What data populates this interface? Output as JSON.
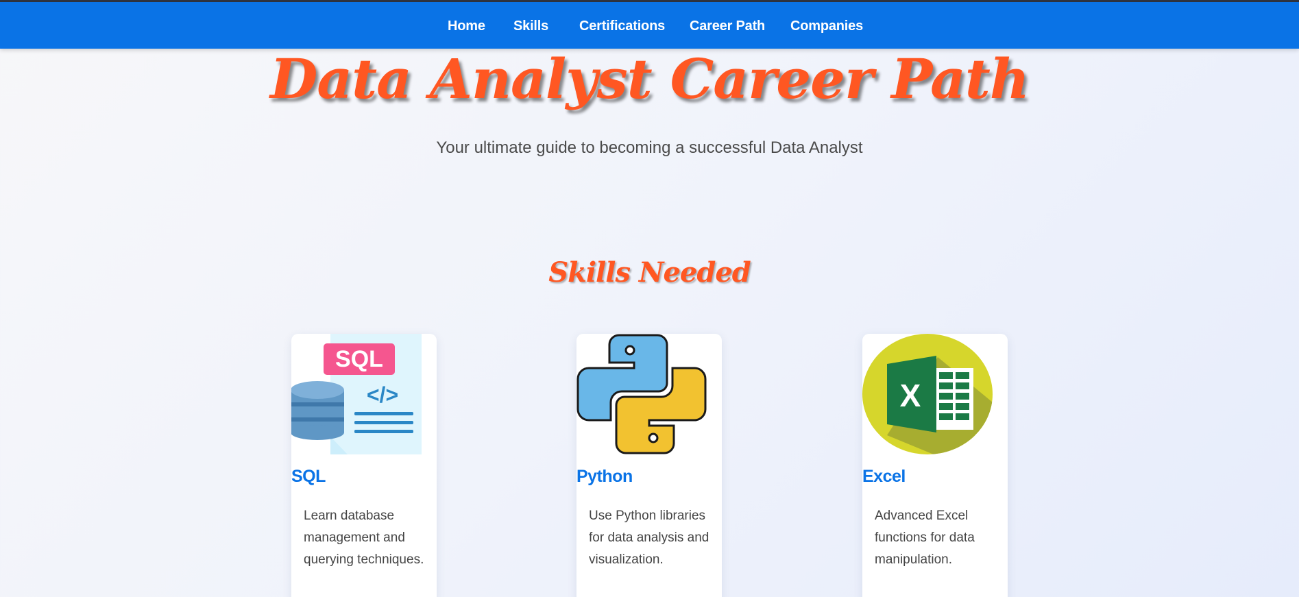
{
  "nav": {
    "items": [
      {
        "label": "Home"
      },
      {
        "label": "Skills"
      },
      {
        "label": "Certifications"
      },
      {
        "label": "Career Path"
      },
      {
        "label": "Companies"
      }
    ]
  },
  "hero": {
    "title": "Data Analyst Career Path",
    "subtitle": "Your ultimate guide to becoming a successful Data Analyst"
  },
  "skills": {
    "heading": "Skills Needed",
    "cards": [
      {
        "icon": "sql-database-icon",
        "icon_badge": "SQL",
        "title": "SQL",
        "description": "Learn database management and querying techniques."
      },
      {
        "icon": "python-logo-icon",
        "title": "Python",
        "description": "Use Python libraries for data analysis and visualization."
      },
      {
        "icon": "excel-logo-icon",
        "icon_badge": "X",
        "title": "Excel",
        "description": "Advanced Excel functions for data manipulation."
      }
    ]
  },
  "colors": {
    "nav_background": "#0a73e6",
    "accent_orange": "#ff5722",
    "card_title_blue": "#0a73e6",
    "body_text": "#444444"
  }
}
